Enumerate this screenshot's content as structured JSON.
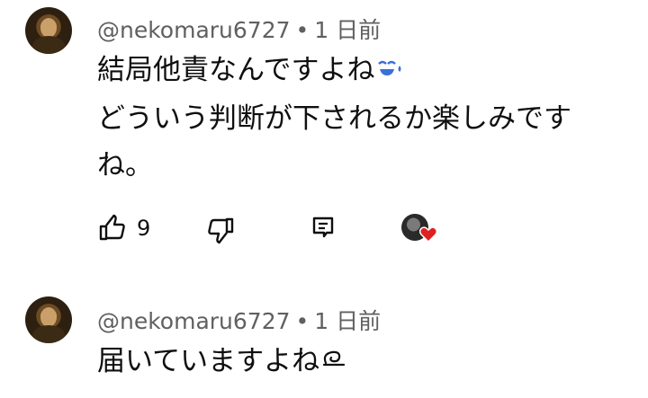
{
  "comments": [
    {
      "username": "@nekomaru6727",
      "separator": "•",
      "time": "1 日前",
      "lines": [
        "結局他責なんですよね",
        "どういう判断が下されるか楽しみです",
        "ね。"
      ],
      "emoji": "sweat-smile-emoji",
      "like_count": "9"
    },
    {
      "username": "@nekomaru6727",
      "separator": "•",
      "time": "1 日前",
      "lines": [
        "届いていますよね"
      ],
      "emoji": "swirl-emoji"
    }
  ],
  "icons": {
    "like": "thumbs-up-icon",
    "dislike": "thumbs-down-icon",
    "reply": "reply-icon",
    "creator_heart": "creator-heart-icon"
  },
  "colors": {
    "meta_text": "#606060",
    "heart": "#e02020"
  }
}
